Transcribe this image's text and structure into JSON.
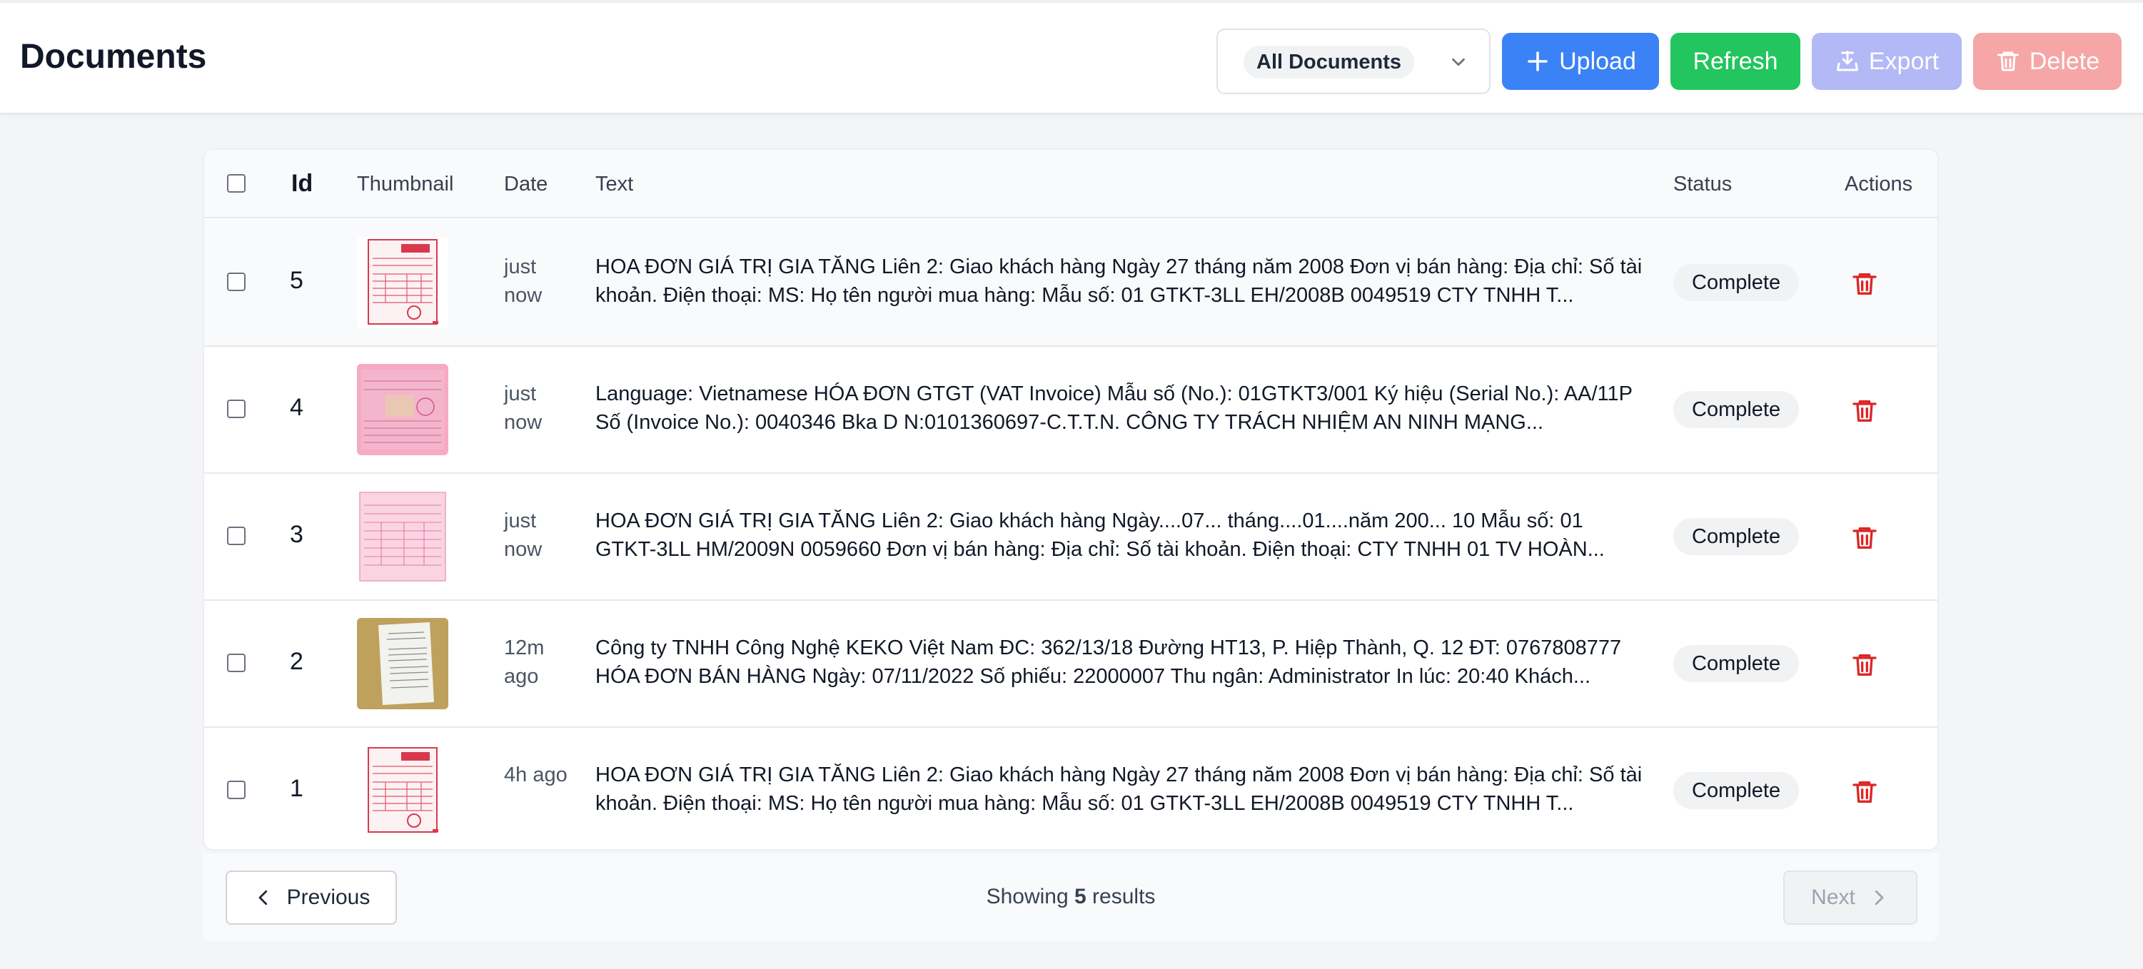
{
  "header": {
    "title": "Documents",
    "filter": {
      "selected": "All Documents"
    },
    "buttons": {
      "upload": "Upload",
      "refresh": "Refresh",
      "export": "Export",
      "delete": "Delete"
    }
  },
  "table": {
    "columns": {
      "id": "Id",
      "thumbnail": "Thumbnail",
      "date": "Date",
      "text": "Text",
      "status": "Status",
      "actions": "Actions"
    },
    "rows": [
      {
        "id": "5",
        "date": "just now",
        "text": "HOA ĐƠN GIÁ TRỊ GIA TĂNG Liên 2: Giao khách hàng Ngày 27 tháng năm 2008 Đơn vị bán hàng: Địa chỉ: Số tài khoản. Điện thoại: MS: Họ tên người mua hàng: Mẫu số: 01 GTKT-3LL EH/2008B 0049519 CTY TNHH T...",
        "status": "Complete",
        "thumb": "invoice-red"
      },
      {
        "id": "4",
        "date": "just now",
        "text": "Language: Vietnamese HÓA ĐƠN GTGT (VAT Invoice) Mẫu số (No.): 01GTKT3/001 Ký hiệu (Serial No.): AA/11P Số (Invoice No.): 0040346 Bka D N:0101360697-C.T.T.N. CÔNG TY TRÁCH NHIỆM AN NINH MẠNG...",
        "status": "Complete",
        "thumb": "invoice-pink"
      },
      {
        "id": "3",
        "date": "just now",
        "text": "HOA ĐƠN GIÁ TRỊ GIA TĂNG Liên 2: Giao khách hàng Ngày....07... tháng....01....năm 200... 10 Mẫu số: 01 GTKT-3LL HM/2009N 0059660 Đơn vị bán hàng: Địa chỉ: Số tài khoản. Điện thoại: CTY TNHH 01 TV HOÀN...",
        "status": "Complete",
        "thumb": "invoice-light"
      },
      {
        "id": "2",
        "date": "12m ago",
        "text": "Công ty TNHH Công Nghệ KEKO Việt Nam ĐC: 362/13/18 Đường HT13, P. Hiệp Thành, Q. 12 ĐT: 0767808777 HÓA ĐƠN BÁN HÀNG Ngày: 07/11/2022 Số phiếu: 22000007 Thu ngân: Administrator In lúc: 20:40 Khách...",
        "status": "Complete",
        "thumb": "receipt-photo"
      },
      {
        "id": "1",
        "date": "4h ago",
        "text": "HOA ĐƠN GIÁ TRỊ GIA TĂNG Liên 2: Giao khách hàng Ngày 27 tháng năm 2008 Đơn vị bán hàng: Địa chỉ: Số tài khoản. Điện thoại: MS: Họ tên người mua hàng: Mẫu số: 01 GTKT-3LL EH/2008B 0049519 CTY TNHH T...",
        "status": "Complete",
        "thumb": "invoice-red"
      }
    ]
  },
  "pagination": {
    "previous": "Previous",
    "next": "Next",
    "showing_prefix": "Showing",
    "showing_count": "5",
    "showing_suffix": "results"
  },
  "colors": {
    "upload": "#3b82f6",
    "refresh": "#22c55e",
    "export_disabled": "#b3b8f6",
    "delete_disabled": "#f6a6a6",
    "trash": "#dc2626"
  },
  "icons": {
    "upload": "plus-icon",
    "export": "export-icon",
    "delete": "trash-icon",
    "filter": "chevron-down-icon",
    "previous": "chevron-left-icon",
    "next": "chevron-right-icon"
  }
}
